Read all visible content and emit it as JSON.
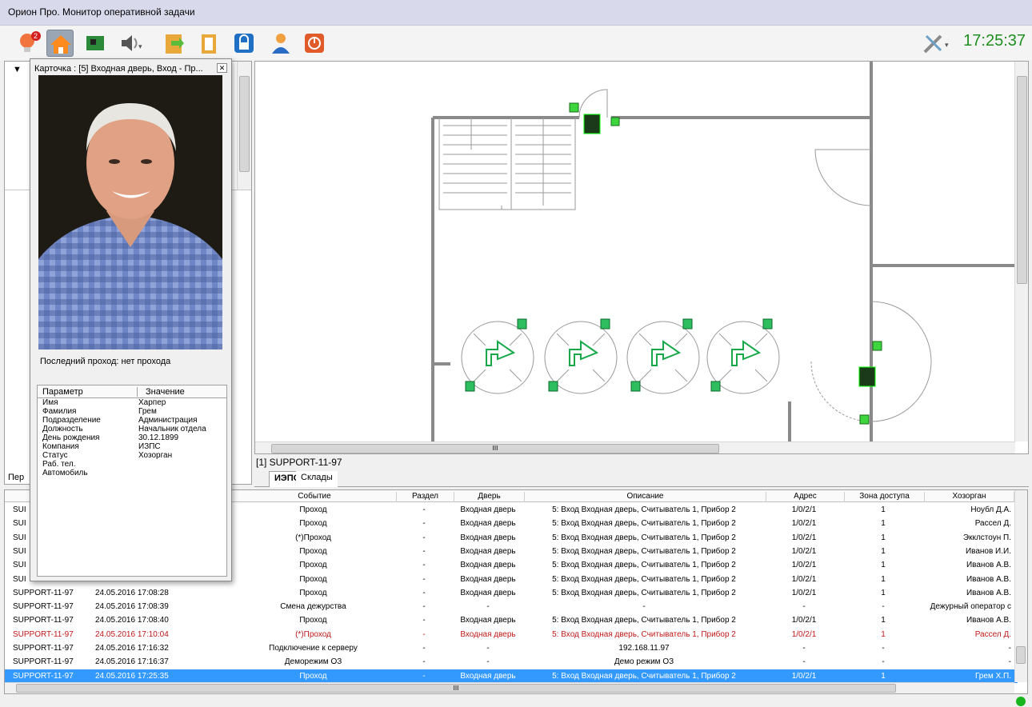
{
  "app": {
    "title": "Орион Про. Монитор оперативной задачи",
    "clock": "17:25:37"
  },
  "toolbar": {
    "alarm_badge": "2"
  },
  "card": {
    "title": "Карточка : [5] Входная дверь, Вход - Пр...",
    "last_pass_label": "Последний проход:",
    "last_pass_value": "нет прохода",
    "param_header": "Параметр",
    "value_header": "Значение",
    "params": [
      {
        "name": "Имя",
        "value": "Харпер"
      },
      {
        "name": "Фамилия",
        "value": "Грем"
      },
      {
        "name": "Подразделение",
        "value": "Администрация"
      },
      {
        "name": "Должность",
        "value": "Начальник отдела"
      },
      {
        "name": "День рождения",
        "value": "30.12.1899"
      },
      {
        "name": "Компания",
        "value": "ИЗПС"
      },
      {
        "name": "Статус",
        "value": "Хозорган"
      },
      {
        "name": "Раб. тел.",
        "value": ""
      },
      {
        "name": "Автомобиль",
        "value": ""
      }
    ]
  },
  "map": {
    "caption": "[1] SUPPORT-11-97",
    "tabs": [
      "ИЭПС",
      "Склады"
    ],
    "left_tab": "Пер",
    "hscroll_mark": "III"
  },
  "grid": {
    "columns": [
      "Событие",
      "Раздел",
      "Дверь",
      "Описание",
      "Адрес",
      "Зона доступа",
      "Хозорган"
    ],
    "rows": [
      {
        "host": "SUI",
        "time": "",
        "event": "Проход",
        "part": "-",
        "door": "Входная дверь",
        "desc": "5: Вход  Входная дверь,  Считыватель 1, Прибор 2",
        "addr": "1/0/2/1",
        "zone": "1",
        "owner": "Ноубл Д.А."
      },
      {
        "host": "SUI",
        "time": "",
        "event": "Проход",
        "part": "-",
        "door": "Входная дверь",
        "desc": "5: Вход  Входная дверь,  Считыватель 1, Прибор 2",
        "addr": "1/0/2/1",
        "zone": "1",
        "owner": "Рассел Д."
      },
      {
        "host": "SUI",
        "time": "",
        "event": "(*)Проход",
        "part": "-",
        "door": "Входная дверь",
        "desc": "5: Вход  Входная дверь,  Считыватель 1, Прибор 2",
        "addr": "1/0/2/1",
        "zone": "1",
        "owner": "Экклстоун П."
      },
      {
        "host": "SUI",
        "time": "",
        "event": "Проход",
        "part": "-",
        "door": "Входная дверь",
        "desc": "5: Вход  Входная дверь,  Считыватель 1, Прибор 2",
        "addr": "1/0/2/1",
        "zone": "1",
        "owner": "Иванов И.И."
      },
      {
        "host": "SUI",
        "time": "",
        "event": "Проход",
        "part": "-",
        "door": "Входная дверь",
        "desc": "5: Вход  Входная дверь,  Считыватель 1, Прибор 2",
        "addr": "1/0/2/1",
        "zone": "1",
        "owner": "Иванов А.В."
      },
      {
        "host": "SUI",
        "time": "",
        "event": "Проход",
        "part": "-",
        "door": "Входная дверь",
        "desc": "5: Вход  Входная дверь,  Считыватель 1, Прибор 2",
        "addr": "1/0/2/1",
        "zone": "1",
        "owner": "Иванов А.В."
      },
      {
        "host": "SUPPORT-11-97",
        "time": "24.05.2016 17:08:28",
        "event": "Проход",
        "part": "-",
        "door": "Входная дверь",
        "desc": "5: Вход  Входная дверь,  Считыватель 1, Прибор 2",
        "addr": "1/0/2/1",
        "zone": "1",
        "owner": "Иванов А.В."
      },
      {
        "host": "SUPPORT-11-97",
        "time": "24.05.2016 17:08:39",
        "event": "Смена дежурства",
        "part": "-",
        "door": "-",
        "desc": "-",
        "addr": "-",
        "zone": "-",
        "owner": "Дежурный оператор с"
      },
      {
        "host": "SUPPORT-11-97",
        "time": "24.05.2016 17:08:40",
        "event": "Проход",
        "part": "-",
        "door": "Входная дверь",
        "desc": "5: Вход  Входная дверь,  Считыватель 1, Прибор 2",
        "addr": "1/0/2/1",
        "zone": "1",
        "owner": "Иванов А.В."
      },
      {
        "host": "SUPPORT-11-97",
        "time": "24.05.2016 17:10:04",
        "event": "(*)Проход",
        "part": "-",
        "door": "Входная дверь",
        "desc": "5: Вход  Входная дверь,  Считыватель 1, Прибор 2",
        "addr": "1/0/2/1",
        "zone": "1",
        "owner": "Рассел Д.",
        "style": "red"
      },
      {
        "host": "SUPPORT-11-97",
        "time": "24.05.2016 17:16:32",
        "event": "Подключение к серверу",
        "part": "-",
        "door": "-",
        "desc": "192.168.11.97",
        "addr": "-",
        "zone": "-",
        "owner": "-"
      },
      {
        "host": "SUPPORT-11-97",
        "time": "24.05.2016 17:16:37",
        "event": "Деморежим ОЗ",
        "part": "-",
        "door": "-",
        "desc": "Демо режим ОЗ",
        "addr": "-",
        "zone": "-",
        "owner": "-"
      },
      {
        "host": "SUPPORT-11-97",
        "time": "24.05.2016 17:25:35",
        "event": "Проход",
        "part": "-",
        "door": "Входная дверь",
        "desc": "5: Вход  Входная дверь,  Считыватель 1, Прибор 2",
        "addr": "1/0/2/1",
        "zone": "1",
        "owner": "Грем Х.П.",
        "style": "selected"
      }
    ],
    "hscroll_mark": "III"
  },
  "status": {
    "connection_color": "#19b51f"
  }
}
